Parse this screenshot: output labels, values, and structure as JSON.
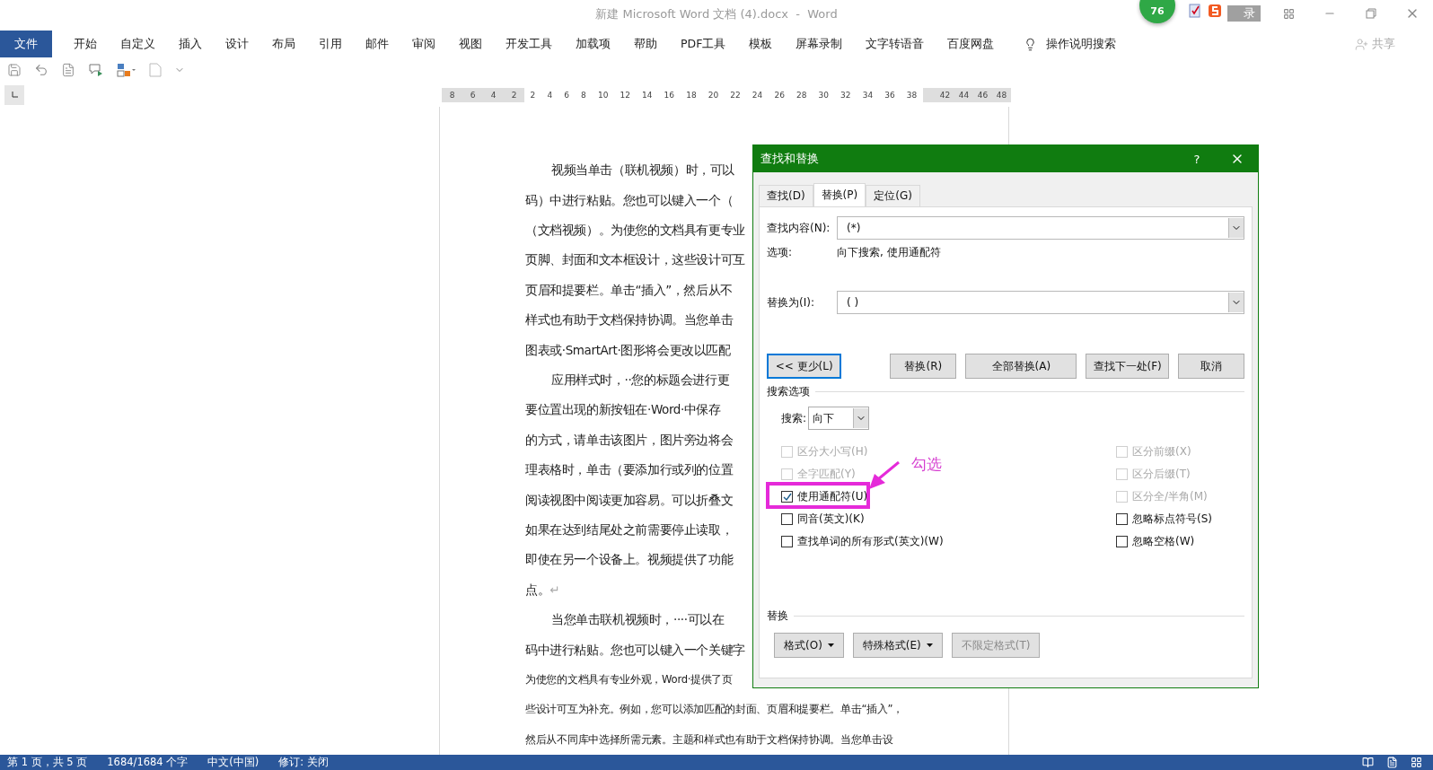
{
  "window": {
    "title": "新建 Microsoft Word 文档 (4).docx  -  Word",
    "badge": "76",
    "login_button": "录"
  },
  "ribbon": {
    "tabs": [
      {
        "label": "文件",
        "kind": "file"
      },
      {
        "label": "开始",
        "kind": "tab"
      },
      {
        "label": "自定义",
        "kind": "tab"
      },
      {
        "label": "插入",
        "kind": "tab"
      },
      {
        "label": "设计",
        "kind": "tab"
      },
      {
        "label": "布局",
        "kind": "tab"
      },
      {
        "label": "引用",
        "kind": "tab"
      },
      {
        "label": "邮件",
        "kind": "tab"
      },
      {
        "label": "审阅",
        "kind": "tab"
      },
      {
        "label": "视图",
        "kind": "tab"
      },
      {
        "label": "开发工具",
        "kind": "tab"
      },
      {
        "label": "加载项",
        "kind": "tab"
      },
      {
        "label": "帮助",
        "kind": "tab"
      },
      {
        "label": "PDF工具",
        "kind": "tab"
      },
      {
        "label": "模板",
        "kind": "tab"
      },
      {
        "label": "屏幕录制",
        "kind": "tab"
      },
      {
        "label": "文字转语音",
        "kind": "tab"
      },
      {
        "label": "百度网盘",
        "kind": "tab"
      }
    ],
    "tell_me": "操作说明搜索",
    "share": "共享"
  },
  "ruler": {
    "left_numbers": [
      "8",
      "6",
      "4",
      "2"
    ],
    "numbers": [
      "2",
      "4",
      "6",
      "8",
      "10",
      "12",
      "14",
      "16",
      "18",
      "20",
      "22",
      "24",
      "26",
      "28",
      "30",
      "32",
      "34",
      "36",
      "38"
    ],
    "right_numbers": [
      "42",
      "44",
      "46",
      "48"
    ]
  },
  "document": {
    "lines": [
      {
        "text": "视频当单击（联机视频）时，可以",
        "indent": true,
        "kind": "normal"
      },
      {
        "text": "码）中进行粘贴。您也可以键入一个（",
        "indent": false,
        "kind": "normal"
      },
      {
        "text": "（文档视频）。为使您的文档具有更专业",
        "indent": false,
        "kind": "normal"
      },
      {
        "text": "页脚、封面和文本框设计，这些设计可互",
        "indent": false,
        "kind": "normal"
      },
      {
        "text": "页眉和提要栏。单击“插入”，然后从不",
        "indent": false,
        "kind": "normal"
      },
      {
        "text": "样式也有助于文档保持协调。当您单击",
        "indent": false,
        "kind": "normal"
      },
      {
        "text": "图表或·SmartArt·图形将会更改以匹配",
        "indent": false,
        "kind": "normal"
      },
      {
        "text": "应用样式时，··您的标题会进行更",
        "indent": true,
        "kind": "normal"
      },
      {
        "text": "要位置出现的新按钮在·Word·中保存",
        "indent": false,
        "kind": "normal"
      },
      {
        "text": "的方式，请单击该图片，图片旁边将会",
        "indent": false,
        "kind": "normal"
      },
      {
        "text": "理表格时，单击（要添加行或列的位置",
        "indent": false,
        "kind": "normal"
      },
      {
        "text": "阅读视图中阅读更加容易。可以折叠文",
        "indent": false,
        "kind": "normal"
      },
      {
        "text": "如果在达到结尾处之前需要停止读取，",
        "indent": false,
        "kind": "normal"
      },
      {
        "text": "即使在另一个设备上。视频提供了功能",
        "indent": false,
        "kind": "normal"
      },
      {
        "text": "点。",
        "indent": false,
        "kind": "normal",
        "paragraph_mark": "↵"
      },
      {
        "text": "当您单击联机视频时，····可以在",
        "indent": true,
        "kind": "normal"
      },
      {
        "text": "码中进行粘贴。您也可以键入一个关键字",
        "indent": false,
        "kind": "normal"
      },
      {
        "text": "为使您的文档具有专业外观，Word·提供了页",
        "indent": false,
        "kind": "small"
      },
      {
        "text": "些设计可互为补充。例如，您可以添加匹配的封面、页眉和提要栏。单击“插入”，",
        "indent": false,
        "kind": "small"
      },
      {
        "text": "然后从不同库中选择所需元素。主题和样式也有助于文档保持协调。当您单击设",
        "indent": false,
        "kind": "small"
      }
    ]
  },
  "dialog": {
    "title": "查找和替换",
    "help": "?",
    "tabs": [
      {
        "label": "查找(D)",
        "selected": false
      },
      {
        "label": "替换(P)",
        "selected": true
      },
      {
        "label": "定位(G)",
        "selected": false
      }
    ],
    "find": {
      "label": "查找内容(N):",
      "value": "(*)"
    },
    "options": {
      "label": "选项:",
      "value": "向下搜索, 使用通配符"
    },
    "replace": {
      "label": "替换为(I):",
      "value": "( )"
    },
    "buttons": [
      {
        "label": "<< 更少(L)",
        "focused": true
      },
      {
        "label": "替换(R)",
        "focused": false
      },
      {
        "label": "全部替换(A)",
        "focused": false
      },
      {
        "label": "查找下一处(F)",
        "focused": false
      },
      {
        "label": "取消",
        "focused": false
      }
    ],
    "search_options": {
      "heading": "搜索选项",
      "search_label": "搜索:",
      "search_value": "向下",
      "left": [
        {
          "label": "区分大小写(H)",
          "checked": false,
          "disabled": true
        },
        {
          "label": "全字匹配(Y)",
          "checked": false,
          "disabled": true
        },
        {
          "label": "使用通配符(U)",
          "checked": true,
          "disabled": false
        },
        {
          "label": "同音(英文)(K)",
          "checked": false,
          "disabled": false
        },
        {
          "label": "查找单词的所有形式(英文)(W)",
          "checked": false,
          "disabled": false
        }
      ],
      "right": [
        {
          "label": "区分前缀(X)",
          "checked": false,
          "disabled": true
        },
        {
          "label": "区分后缀(T)",
          "checked": false,
          "disabled": true
        },
        {
          "label": "区分全/半角(M)",
          "checked": false,
          "disabled": true
        },
        {
          "label": "忽略标点符号(S)",
          "checked": false,
          "disabled": false
        },
        {
          "label": "忽略空格(W)",
          "checked": false,
          "disabled": false
        }
      ]
    },
    "replace_section": {
      "heading": "替换",
      "buttons": [
        {
          "label": "格式(O)",
          "dropdown": true,
          "disabled": false
        },
        {
          "label": "特殊格式(E)",
          "dropdown": true,
          "disabled": false
        },
        {
          "label": "不限定格式(T)",
          "dropdown": false,
          "disabled": true
        }
      ]
    }
  },
  "annotation": {
    "text": "勾选"
  },
  "status_bar": {
    "items": [
      "第 1 页，共 5 页",
      "1684/1684 个字",
      "中文(中国)",
      "修订: 关闭"
    ]
  }
}
